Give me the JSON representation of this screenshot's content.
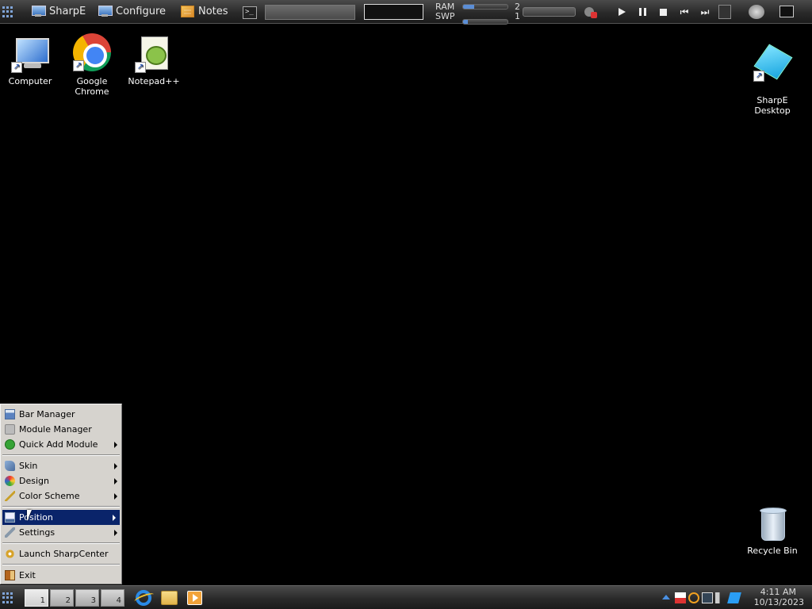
{
  "topbar": {
    "sharpe_label": "SharpE",
    "configure_label": "Configure",
    "notes_label": "Notes",
    "terminal_glyph": ">_",
    "ram_label": "RAM",
    "ram_value": "2",
    "ram_fill_fraction": 0.25,
    "swp_label": "SWP",
    "swp_value": "1",
    "swp_fill_fraction": 0.1
  },
  "desktop": {
    "icons": [
      {
        "label": "Computer",
        "icon": "computer-icon"
      },
      {
        "label": "Google Chrome",
        "icon": "chrome-icon"
      },
      {
        "label": "Notepad++",
        "icon": "notepad-plus-plus-icon"
      },
      {
        "label": "SharpE\nDesktop",
        "icon": "sharpe-cube-icon"
      },
      {
        "label": "Recycle Bin",
        "icon": "recycle-bin-icon"
      }
    ]
  },
  "menu": {
    "items": [
      {
        "label": "Bar Manager",
        "submenu": false
      },
      {
        "label": "Module Manager",
        "submenu": false
      },
      {
        "label": "Quick Add Module",
        "submenu": true
      },
      {
        "label": "Skin",
        "submenu": true
      },
      {
        "label": "Design",
        "submenu": true
      },
      {
        "label": "Color Scheme",
        "submenu": true
      },
      {
        "label": "Position",
        "submenu": true,
        "selected": true
      },
      {
        "label": "Settings",
        "submenu": true
      },
      {
        "label": "Launch SharpCenter",
        "submenu": false
      },
      {
        "label": "Exit",
        "submenu": false
      }
    ],
    "selected_color": "#0a246a"
  },
  "taskbar": {
    "desktops": [
      "1",
      "2",
      "3",
      "4"
    ],
    "clock_time": "4:11 AM",
    "clock_date": "10/13/2023"
  },
  "colors": {
    "background": "#000000",
    "bar": "#2a2a2a",
    "accent": "#5b8ed6"
  }
}
